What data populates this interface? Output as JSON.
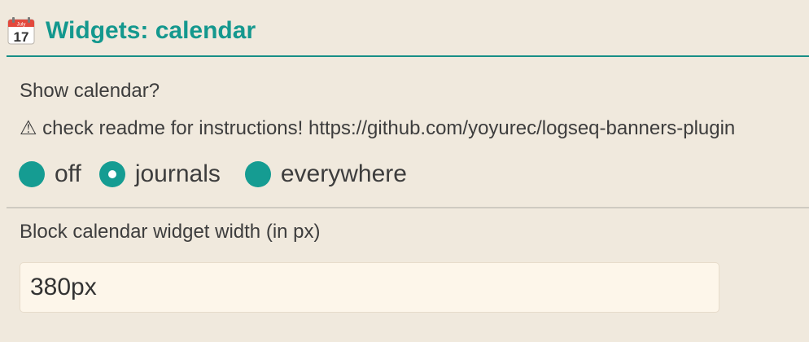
{
  "section": {
    "title": "Widgets: calendar",
    "icon": "calendar-icon",
    "icon_month": "July",
    "icon_day": "17",
    "accent_color": "#14988e"
  },
  "show_calendar": {
    "question": "Show calendar?",
    "description": "⚠ check readme for instructions! https://github.com/yoyurec/logseq-banners-plugin",
    "options": [
      {
        "label": "off",
        "selected": false
      },
      {
        "label": "journals",
        "selected": true
      },
      {
        "label": "everywhere",
        "selected": false
      }
    ]
  },
  "width_setting": {
    "label": "Block calendar widget width (in px)",
    "value": "380px"
  }
}
